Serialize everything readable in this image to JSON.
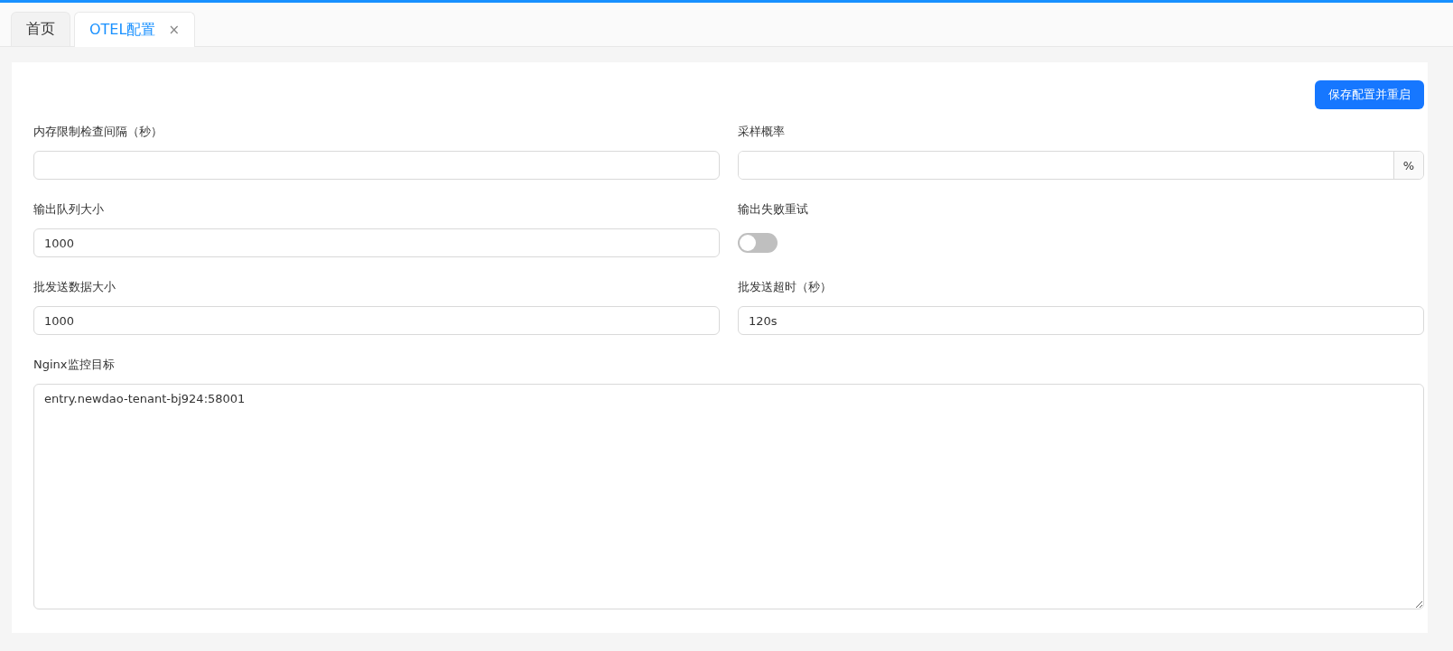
{
  "tabs": [
    {
      "label": "首页",
      "selected": false
    },
    {
      "label": "OTEL配置",
      "selected": true,
      "close": "×"
    }
  ],
  "save_button": "保存配置并重启",
  "fields": [
    {
      "kind": "text",
      "label": "内存限制检查间隔（秒）"
    },
    {
      "kind": "suffix",
      "label": "采样概率",
      "suffix": "%"
    },
    {
      "kind": "text",
      "label": "输出队列大小",
      "value": "1000"
    },
    {
      "kind": "switch",
      "label": "输出失败重试",
      "on": false
    },
    {
      "kind": "text",
      "label": "批发送数据大小",
      "value": "1000"
    },
    {
      "kind": "text",
      "label": "批发送超时（秒）",
      "value": "120s"
    },
    {
      "kind": "textarea",
      "label": "Nginx监控目标",
      "value": "entry.newdao-tenant-bj924:58001"
    }
  ]
}
